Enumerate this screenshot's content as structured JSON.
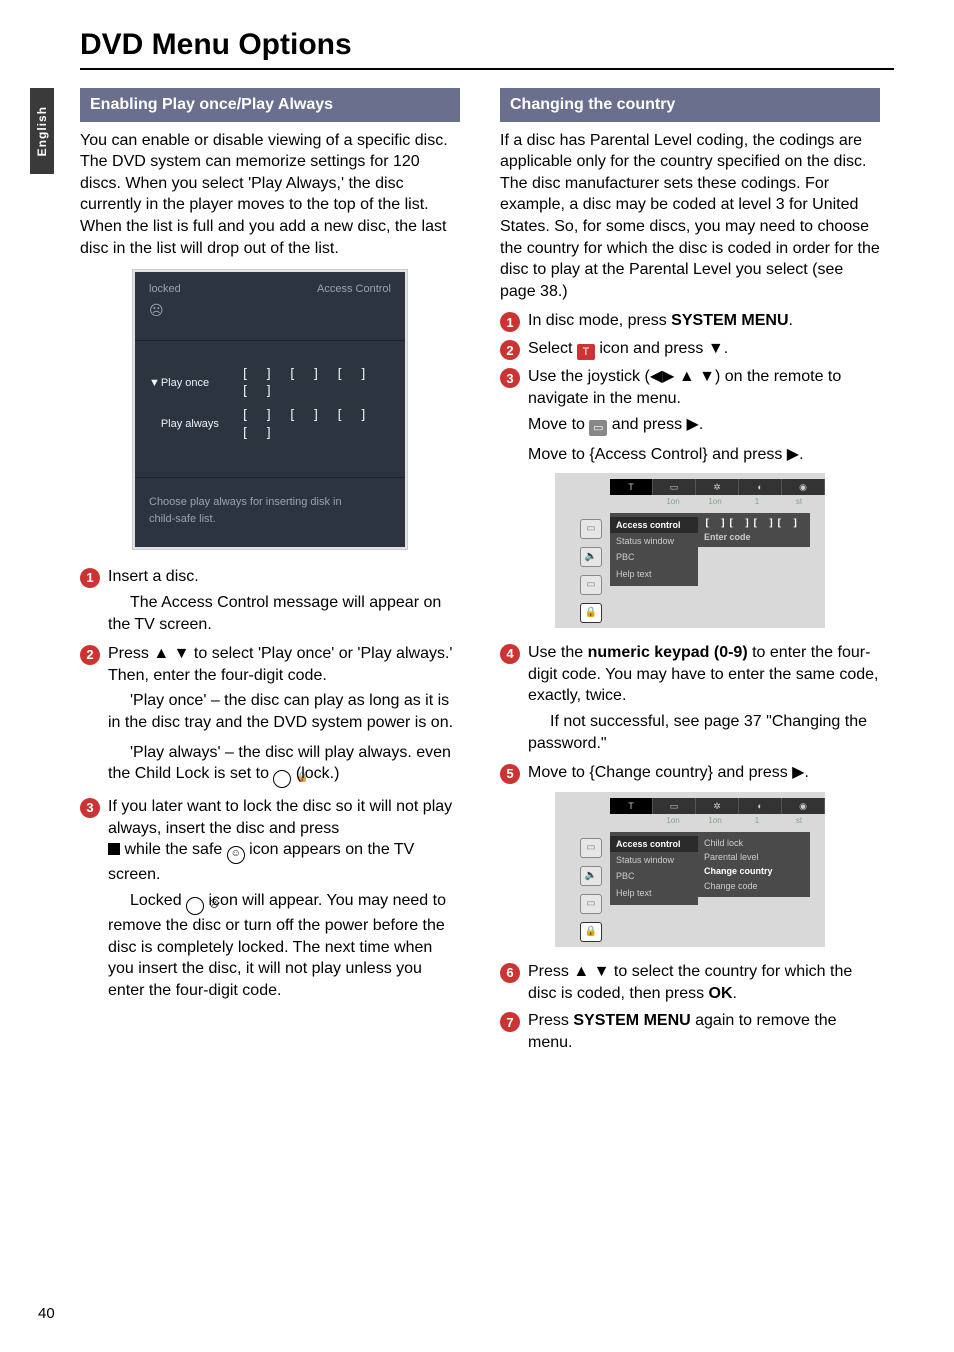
{
  "page": {
    "title": "DVD Menu Options",
    "lang_tab": "English",
    "number": "40"
  },
  "left": {
    "section_title": "Enabling Play once/Play Always",
    "intro": "You can enable or disable viewing of a specific disc.  The DVD system can memorize settings for 120 discs.  When you select 'Play Always,' the disc currently in the player moves to the top of the list.  When the list is full and you add a new disc, the last disc in the list will drop out of the list.",
    "dialog": {
      "locked": "locked",
      "title_right": "Access Control",
      "row1_label": "Play once",
      "row1_code": "[ ] [ ] [ ] [ ]",
      "row2_label": "Play always",
      "row2_code": "[ ] [ ] [ ] [ ]",
      "bottom1": "Choose play always for inserting disk in",
      "bottom2": "child-safe list."
    },
    "step1": "Insert a disc.",
    "step1_sub": "The Access Control message will appear on the TV screen.",
    "step2": "Press ▲ ▼  to select 'Play once' or 'Play always.'  Then, enter the four-digit code.",
    "step2_sub1": "'Play once' – the disc can play as long as it is in the disc tray and the DVD system power is on.",
    "step2_sub2": "'Play always' – the disc will play always. even the Child Lock is set to ",
    "step2_sub2_tail": " (lock.)",
    "step3": "If you later want to lock the disc so it will not play always, insert the disc and press  ",
    "step3_tail": "  while the safe ",
    "step3_tail2": " icon appears on the TV screen.",
    "step3_sub": "Locked ",
    "step3_sub_tail": " icon will appear.  You may need to remove the disc or turn off the power before the disc is completely locked.  The next time when you insert the disc, it will not play unless you enter the four-digit code."
  },
  "right": {
    "section_title": "Changing the country",
    "intro": "If a disc has Parental Level coding, the codings are applicable only for the country specified on the disc.  The disc manufacturer sets these codings.  For example, a disc may be coded at level 3 for United States.  So, for some discs, you may need to choose the country for which the disc is coded in order for the disc to play at the Parental Level you select (see page 38.)",
    "step1_pre": "In disc mode, press ",
    "step1_bold": "SYSTEM MENU",
    "step1_post": ".",
    "step2_pre": "Select ",
    "step2_post": " icon and press ▼.",
    "step3": "Use the joystick (◀▶ ▲ ▼) on the remote to navigate in the menu.",
    "step3_sub1_pre": "Move to ",
    "step3_sub1_post": " and press ▶.",
    "step3_sub2": "Move to {Access Control} and press ▶.",
    "osd1": {
      "top_labels": [
        "1on",
        "1on",
        "1",
        "st"
      ],
      "menu": [
        "Access control",
        "Status window",
        "PBC",
        "Help text"
      ],
      "right_line1": "[  ][  ][  ][  ]",
      "right_line2": "Enter code"
    },
    "step4_pre": "Use the ",
    "step4_bold": "numeric keypad (0-9)",
    "step4_post": " to enter the four-digit code.  You may have to enter the same code, exactly, twice.",
    "step4_sub": "If not successful, see page 37 \"Changing the password.\"",
    "step5": "Move to {Change country} and press ▶.",
    "osd2": {
      "top_labels": [
        "1on",
        "1on",
        "1",
        "st"
      ],
      "menu": [
        "Access control",
        "Status window",
        "PBC",
        "Help text"
      ],
      "right": [
        "Child lock",
        "Parental level",
        "Change country",
        "Change code"
      ]
    },
    "step6_pre": "Press ▲ ▼ to select the country for which the disc is coded, then press ",
    "step6_bold": "OK",
    "step6_post": ".",
    "step7_pre": "Press ",
    "step7_bold": "SYSTEM MENU",
    "step7_post": " again to remove the menu."
  }
}
